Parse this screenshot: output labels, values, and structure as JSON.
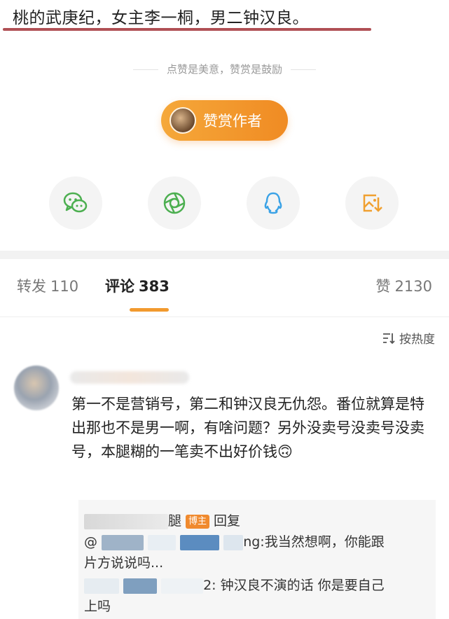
{
  "post": {
    "tail_text": "桃的武庚纪，女主李一桐，男二钟汉良。"
  },
  "reward": {
    "hint": "点赞是美意，赞赏是鼓励",
    "button_label": "赞赏作者"
  },
  "share": {
    "items": [
      {
        "icon": "wechat-icon",
        "color": "#4caf50"
      },
      {
        "icon": "moments-icon",
        "color": "#4caf50"
      },
      {
        "icon": "qq-icon",
        "color": "#3aa2e6"
      },
      {
        "icon": "save-image-icon",
        "color": "#f0a030"
      }
    ]
  },
  "tabs": {
    "repost": {
      "label": "转发",
      "count": "110"
    },
    "comment": {
      "label": "评论",
      "count": "383"
    },
    "like": {
      "label": "赞",
      "count": "2130"
    }
  },
  "sort": {
    "label": "按热度"
  },
  "comment": {
    "text": "第一不是营销号，第二和钟汉良无仇怨。番位就算是特出那也不是男一啊，有啥问题？另外没卖号没卖号没卖号，本腿糊的一笔卖不出好价钱🙃",
    "replies": {
      "author_suffix": "腿",
      "badge": "博主",
      "reply_word": "回复",
      "line1_prefix": "@",
      "line1_suffix": "ng:我当然想啊，你能跟",
      "line2": "片方说说吗...",
      "line3_suffix": "2: 钟汉良不演的话 你是要自己",
      "line4": "上吗"
    }
  },
  "colors": {
    "accent": "#f29a2e",
    "underline": "#b05055"
  }
}
